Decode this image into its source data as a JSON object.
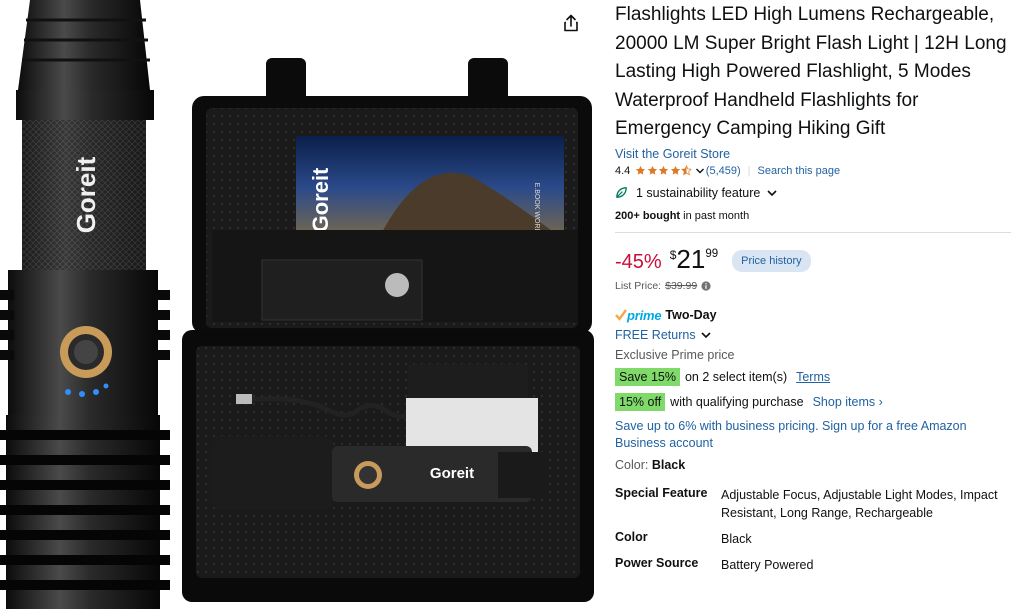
{
  "product": {
    "title": "Flashlights LED High Lumens Rechargeable, 20000 LM Super Bright Flash Light | 12H Long Lasting High Powered Flashlight, 5 Modes Waterproof Handheld Flashlights for Emergency Camping Hiking Gift",
    "store_link": "Visit the Goreit Store",
    "rating_value": "4.4",
    "rating_count": "(5,459)",
    "search_page": "Search this page",
    "sustainability": "1 sustainability feature",
    "bought_bold": "200+ bought",
    "bought_rest": " in past month"
  },
  "image": {
    "brand_mark": "Goreit",
    "brand_reg": "®",
    "case_label": "E.BOOK WORLD"
  },
  "pricing": {
    "discount": "-45%",
    "currency": "$",
    "whole": "21",
    "fraction": "99",
    "price_history": "Price history",
    "list_price_label": "List Price:",
    "list_price_value": "$39.99"
  },
  "delivery": {
    "prime": "prime",
    "prime_speed": "Two-Day",
    "free_returns": "FREE Returns",
    "exclusive": "Exclusive Prime price"
  },
  "promotions": {
    "save_badge": "Save 15%",
    "save_text": "on 2 select item(s)",
    "terms": "Terms",
    "off_badge": "15% off",
    "off_text": "with qualifying purchase",
    "shop_items": "Shop items ›",
    "business": "Save up to 6% with business pricing. Sign up for a free Amazon Business account"
  },
  "color": {
    "label": "Color:",
    "value": "Black"
  },
  "specs": [
    {
      "key": "Special Feature",
      "value": "Adjustable Focus, Adjustable Light Modes, Impact Resistant, Long Range, Rechargeable"
    },
    {
      "key": "Color",
      "value": "Black"
    },
    {
      "key": "Power Source",
      "value": "Battery Powered"
    }
  ],
  "icons": {
    "share": "share-icon",
    "star": "star-icon",
    "leaf": "leaf-icon",
    "chevron": "chevron-down-icon",
    "info": "info-icon"
  },
  "colors": {
    "link": "#2162a1",
    "discount": "#cc0c39",
    "star": "#de7921",
    "badge_green": "#7fda69",
    "prime": "#00a8e1",
    "price_history_bg": "#d9e5f2"
  }
}
